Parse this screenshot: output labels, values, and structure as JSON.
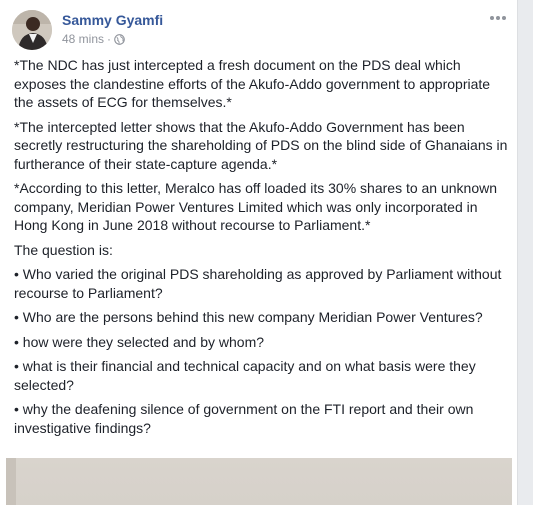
{
  "post": {
    "author": "Sammy Gyamfi",
    "timestamp": "48 mins",
    "separator": "·",
    "privacy_icon": "globe-icon",
    "paragraphs": [
      "*The NDC has just intercepted a fresh document on the PDS deal which exposes the clandestine efforts of the Akufo-Addo government to appropriate the assets of ECG for themselves.*",
      "*The intercepted letter shows that the Akufo-Addo Government has been secretly restructuring the shareholding of PDS on the blind side of Ghanaians in furtherance of their state-capture agenda.*",
      "*According to this letter, Meralco has off loaded its 30% shares to an unknown company, Meridian Power Ventures Limited which was only incorporated in Hong Kong in June 2018 without recourse to Parliament.*",
      "The question is:",
      "• Who varied the original PDS shareholding as approved by Parliament without recourse to Parliament?",
      "• Who are the persons behind this new company Meridian Power Ventures?",
      "• how were they selected and by whom?",
      "• what is their financial and technical capacity and on what basis were they selected?",
      "• why the deafening silence of government on the FTI report and their own investigative findings?"
    ]
  },
  "colors": {
    "author": "#365899",
    "meta": "#90949c",
    "text": "#1d2129",
    "page_bg": "#e9ebee"
  }
}
